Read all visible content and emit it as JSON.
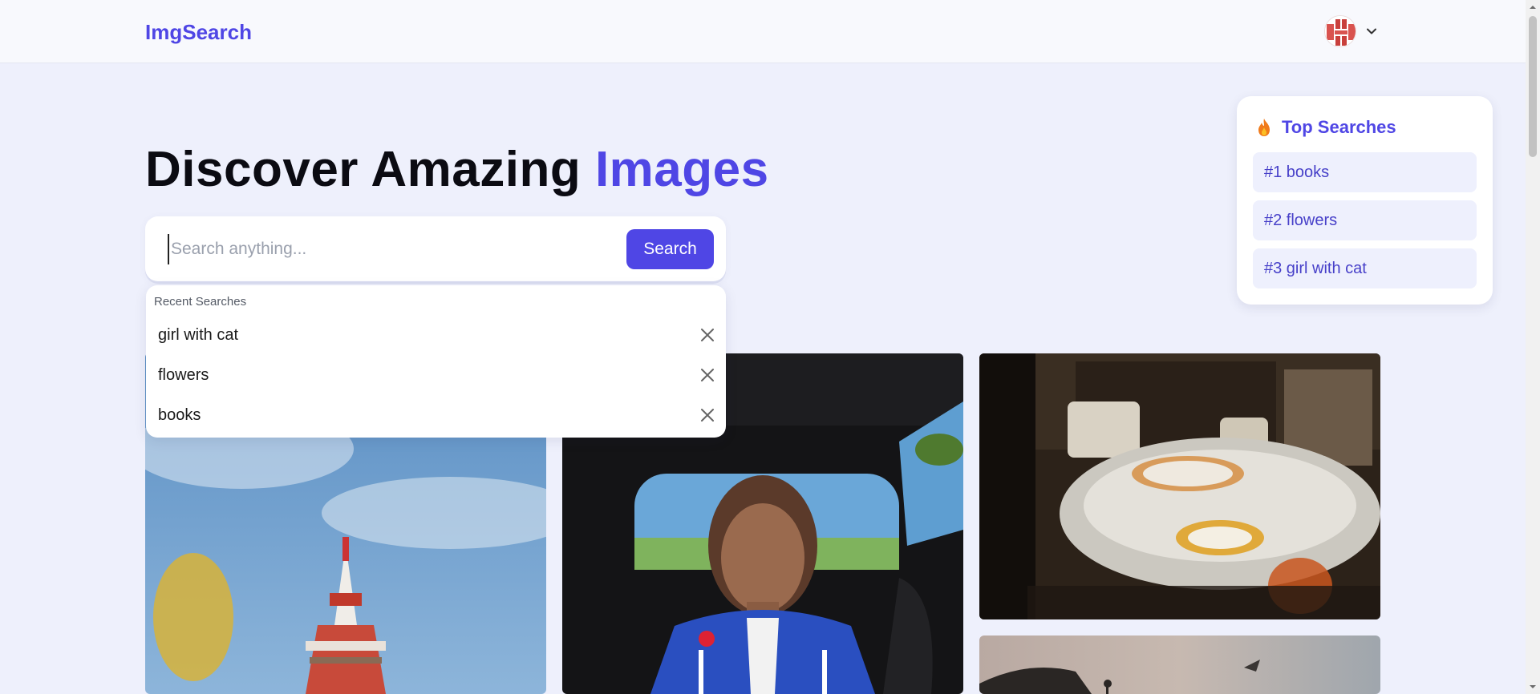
{
  "header": {
    "logo": "ImgSearch",
    "avatar_icon": "user-avatar-icon",
    "menu_icon": "chevron-down-icon"
  },
  "hero": {
    "title_main": "Discover Amazing ",
    "title_accent": "Images"
  },
  "search": {
    "placeholder": "Search anything...",
    "value": "",
    "button_label": "Search"
  },
  "recent": {
    "title": "Recent Searches",
    "items": [
      {
        "label": "girl with cat"
      },
      {
        "label": "flowers"
      },
      {
        "label": "books"
      }
    ],
    "remove_icon": "close-icon"
  },
  "top_searches": {
    "title": "Top Searches",
    "icon": "flame-icon",
    "items": [
      {
        "label": "#1 books"
      },
      {
        "label": "#2 flowers"
      },
      {
        "label": "#3 girl with cat"
      }
    ]
  },
  "colors": {
    "accent": "#4f46e5",
    "background": "#eef0fc",
    "top_item_bg": "#eef0fd"
  }
}
